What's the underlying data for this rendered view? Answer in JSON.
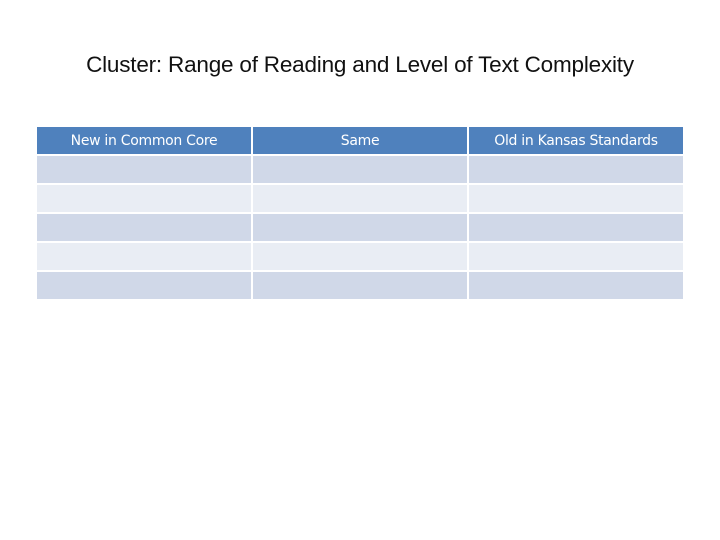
{
  "slide": {
    "title": "Cluster:  Range of Reading and Level of Text Complexity"
  },
  "table": {
    "headers": [
      "New in Common Core",
      "Same",
      "Old in Kansas Standards"
    ],
    "rows": [
      [
        "",
        "",
        ""
      ],
      [
        "",
        "",
        ""
      ],
      [
        "",
        "",
        ""
      ],
      [
        "",
        "",
        ""
      ],
      [
        "",
        "",
        ""
      ]
    ],
    "colors": {
      "header_bg": "#4f81bd",
      "header_text": "#ffffff",
      "row_odd": "#d0d8e8",
      "row_even": "#e9edf4"
    }
  }
}
